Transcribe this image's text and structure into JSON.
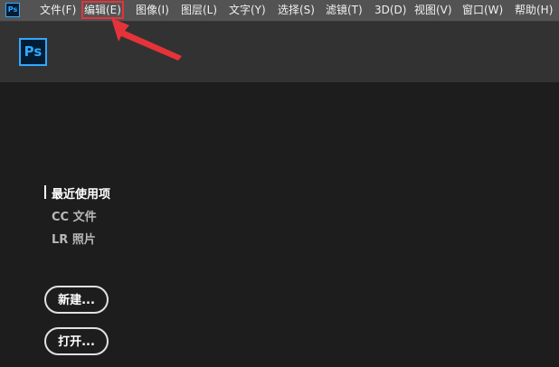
{
  "app": {
    "small_icon_text": "Ps",
    "logo_text": "Ps",
    "brand_color": "#31a8ff"
  },
  "menu": {
    "items": [
      {
        "label": "文件(F)"
      },
      {
        "label": "编辑(E)",
        "highlighted": true
      },
      {
        "label": "图像(I)"
      },
      {
        "label": "图层(L)"
      },
      {
        "label": "文字(Y)"
      },
      {
        "label": "选择(S)"
      },
      {
        "label": "滤镜(T)"
      },
      {
        "label": "3D(D)"
      },
      {
        "label": "视图(V)"
      },
      {
        "label": "窗口(W)"
      },
      {
        "label": "帮助(H)"
      }
    ]
  },
  "annotation": {
    "highlight_color": "#e5333a",
    "arrow_color": "#e5333a"
  },
  "start": {
    "nav": {
      "recent": "最近使用项",
      "cc_files": "CC 文件",
      "lr_photos": "LR 照片"
    },
    "buttons": {
      "new": "新建...",
      "open": "打开..."
    }
  }
}
